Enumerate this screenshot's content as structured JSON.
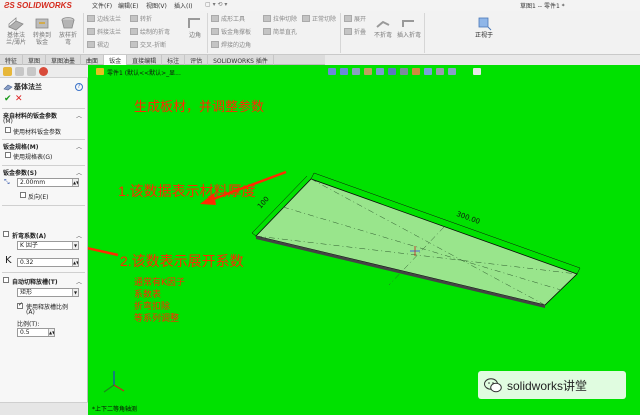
{
  "app": {
    "logo": "SOLIDWORKS",
    "menus": [
      "文件(F)",
      "编辑(E)",
      "视图(V)",
      "插入(I)"
    ],
    "document_title": "草图1 -- 零件1 *"
  },
  "ribbon": {
    "big_buttons": [
      {
        "label": "基体法\n兰/薄片"
      },
      {
        "label": "转换到\n钣金"
      },
      {
        "label": "放样折\n弯"
      }
    ],
    "small_items": [
      {
        "label": "边线法兰"
      },
      {
        "label": "斜接法兰"
      },
      {
        "label": "褶边"
      },
      {
        "label": "转折"
      },
      {
        "label": "绘制的折弯"
      },
      {
        "label": "交叉-折断"
      },
      {
        "label": "边角"
      },
      {
        "label": "成形工具"
      },
      {
        "label": "钣金角撑板"
      },
      {
        "label": "焊接的边角"
      },
      {
        "label": "拉伸切除"
      },
      {
        "label": "简单直孔"
      },
      {
        "label": "正常切除"
      },
      {
        "label": "展开"
      },
      {
        "label": "折叠"
      },
      {
        "label": "不折弯"
      },
      {
        "label": "插入折弯"
      },
      {
        "label": "正视于"
      }
    ]
  },
  "tabs": [
    {
      "label": "特征"
    },
    {
      "label": "草图"
    },
    {
      "label": "草图油墨"
    },
    {
      "label": "曲面"
    },
    {
      "label": "钣金"
    },
    {
      "label": "直接编辑"
    },
    {
      "label": "标注"
    },
    {
      "label": "评估"
    },
    {
      "label": "SOLIDWORKS 插件"
    }
  ],
  "active_tab": "钣金",
  "panel": {
    "title": "基体法兰",
    "help": "?",
    "ok": "✔",
    "cancel": "✕",
    "sec_material": {
      "title": "来自材料的钣金参数",
      "suffix": "(M)",
      "checkbox": "使用材料钣金参数"
    },
    "sec_gauge": {
      "title": "钣金规格(M)",
      "checkbox": "使用规格表(G)"
    },
    "sec_params": {
      "title": "钣金参数(S)",
      "thickness": "2.00mm",
      "reverse": "反向(E)"
    },
    "sec_bend": {
      "title": "折弯系数(A)",
      "type": "K 因子",
      "k_label": "K",
      "k_value": "0.32"
    },
    "sec_relief": {
      "title": "自动切释放槽(T)",
      "type": "矩形",
      "ratio_cb": "使用释放槽比例",
      "ratio_cb2": "(A)",
      "ratio_label": "比例(T):",
      "ratio_value": "0.5"
    }
  },
  "viewport": {
    "breadcrumb": "零件1 (默认<<默认>_显...",
    "annotation_title": "生成板材，并调整参数",
    "annotation_1": "1.该数据表示材料厚度",
    "annotation_2": "2.该数表示展开系数",
    "notes": [
      "通常有K因子",
      "系数表",
      "折弯扣除",
      "等系列调整"
    ],
    "dim_length": "300.00",
    "dim_width": "100",
    "view_label": "*上下二等角轴测",
    "watermark": "solidworks讲堂"
  },
  "colors": {
    "viewport_bg": "#00e100",
    "annotation": "#ff2a00",
    "plate_fill": "#99e58c",
    "brand_red": "#d52b1e"
  }
}
